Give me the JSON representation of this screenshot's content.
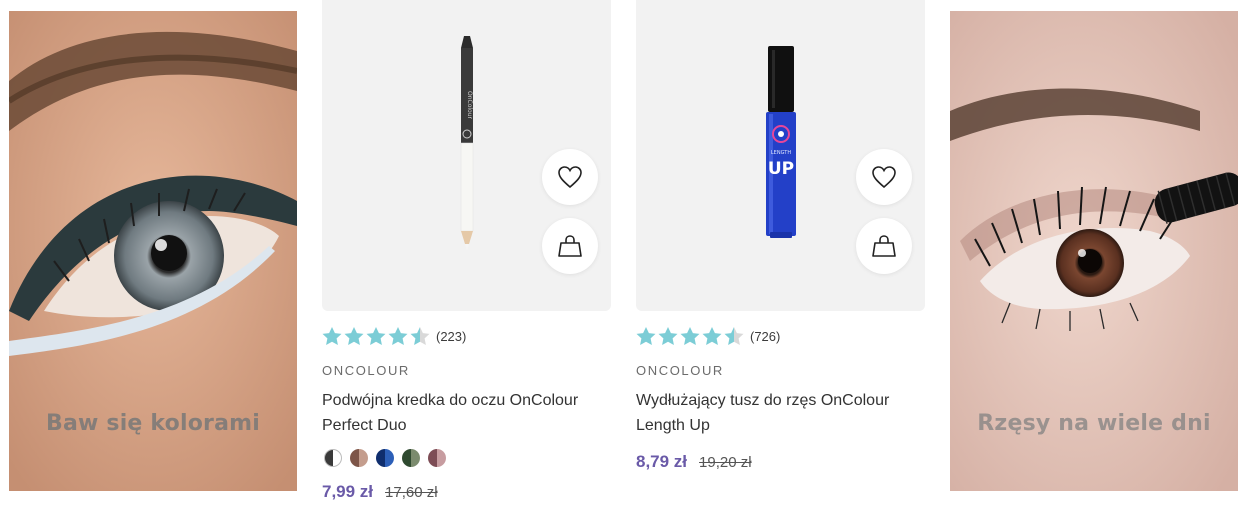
{
  "promos": [
    {
      "text": "Baw się kolorami"
    },
    {
      "text": "Rzęsy na wiele dni"
    }
  ],
  "products": [
    {
      "rating": 4.5,
      "review_count": "(223)",
      "brand": "ONCOLOUR",
      "name_line1": "Podwójna kredka do oczu OnColour",
      "name_line2": "Perfect Duo",
      "pencil_label": "OnColour",
      "swatches": [
        "#3a3a3a",
        "#a57a6c",
        "#1d3f8a",
        "#3f5a3e",
        "#9c6c70"
      ],
      "price_current": "7,99 zł",
      "price_old": "17,60 zł"
    },
    {
      "rating": 4.5,
      "review_count": "(726)",
      "brand": "ONCOLOUR",
      "name_line1": "Wydłużający tusz do rzęs OnColour",
      "name_line2": "Length Up",
      "mascara_label_top": "LENGTH",
      "mascara_label_big": "UP",
      "price_current": "8,79 zł",
      "price_old": "19,20 zł"
    }
  ],
  "icons": {
    "wishlist": "heart-icon",
    "cart": "shopping-bag-icon",
    "star": "star-icon"
  },
  "colors": {
    "star": "#7ccdd6",
    "star_empty": "#d9d9d9",
    "price": "#6a5aa8"
  }
}
